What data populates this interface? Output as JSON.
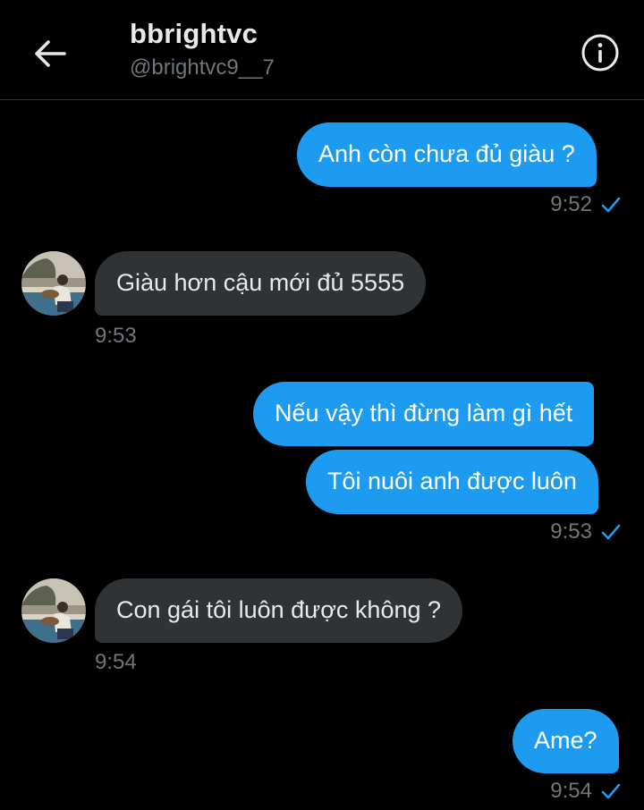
{
  "header": {
    "name": "bbrightvc",
    "handle": "@brightvc9__7"
  },
  "messages": [
    {
      "direction": "sent",
      "text": "Anh còn chưa đủ giàu ?",
      "time": "9:52"
    },
    {
      "direction": "received",
      "text": "Giàu hơn cậu mới đủ 5555",
      "time": "9:53"
    },
    {
      "direction": "sent",
      "text": "Nếu vậy thì đừng làm gì hết"
    },
    {
      "direction": "sent",
      "text": "Tôi nuôi anh được luôn",
      "time": "9:53"
    },
    {
      "direction": "received",
      "text": "Con gái tôi luôn được không ?",
      "time": "9:54"
    },
    {
      "direction": "sent",
      "text": "Ame?",
      "time": "9:54"
    }
  ],
  "colors": {
    "sent_bubble": "#1d9bf0",
    "received_bubble": "#2f3336",
    "background": "#000000",
    "muted_text": "#71767b"
  },
  "icons": {
    "back": "arrow-left-icon",
    "info": "info-icon",
    "read": "checkmark-icon"
  }
}
